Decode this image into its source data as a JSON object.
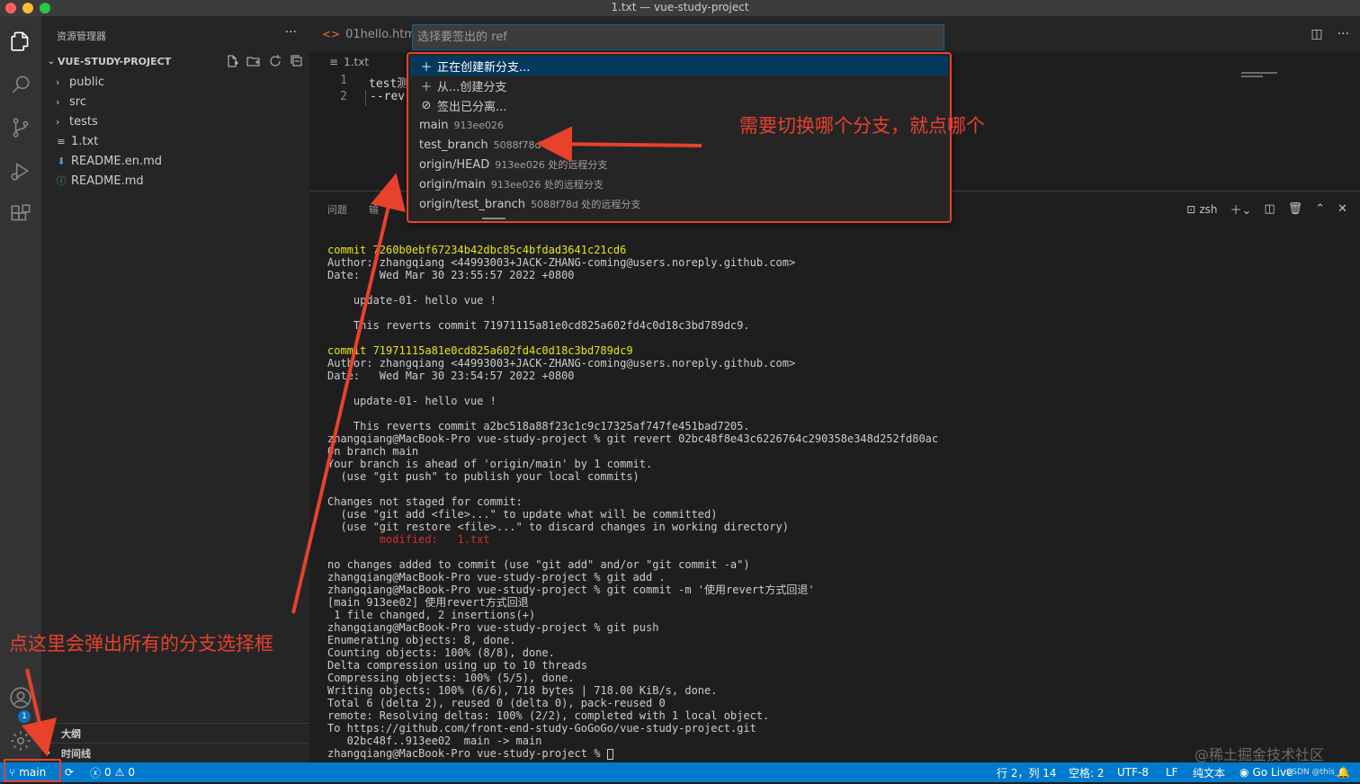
{
  "window": {
    "title": "1.txt — vue-study-project"
  },
  "sidebar": {
    "header": "资源管理器",
    "more": "···",
    "project": "VUE-STUDY-PROJECT",
    "items": [
      {
        "label": "public",
        "kind": "folder"
      },
      {
        "label": "src",
        "kind": "folder"
      },
      {
        "label": "tests",
        "kind": "folder"
      },
      {
        "label": "1.txt",
        "kind": "file-text"
      },
      {
        "label": "README.en.md",
        "kind": "file-md-download"
      },
      {
        "label": "README.md",
        "kind": "file-md-info"
      }
    ],
    "outline": "大纲",
    "timeline": "时间线"
  },
  "tabs": [
    {
      "label": "01hello.html",
      "icon": "code-icon"
    }
  ],
  "breadcrumb": "1.txt",
  "editor": {
    "lines": [
      {
        "num": "1",
        "text": "test测"
      },
      {
        "num": "2",
        "text": "--rev"
      }
    ]
  },
  "quickpick": {
    "placeholder": "选择要签出的 ref",
    "items": [
      {
        "icon": "plus-icon",
        "label": "正在创建新分支...",
        "desc": "",
        "selected": true
      },
      {
        "icon": "plus-icon",
        "label": "从...创建分支",
        "desc": "",
        "selected": false
      },
      {
        "icon": "detach-icon",
        "label": "签出已分离...",
        "desc": "",
        "selected": false
      },
      {
        "icon": "",
        "label": "main",
        "desc": "913ee026",
        "selected": false
      },
      {
        "icon": "",
        "label": "test_branch",
        "desc": "5088f78d",
        "selected": false
      },
      {
        "icon": "",
        "label": "origin/HEAD",
        "desc": "913ee026 处的远程分支",
        "selected": false
      },
      {
        "icon": "",
        "label": "origin/main",
        "desc": "913ee026 处的远程分支",
        "selected": false
      },
      {
        "icon": "",
        "label": "origin/test_branch",
        "desc": "5088f78d 处的远程分支",
        "selected": false
      }
    ]
  },
  "panel": {
    "tabs": [
      "问题",
      "输"
    ],
    "shell": "zsh"
  },
  "terminal": {
    "lines": [
      {
        "text": "commit 7260b0ebf67234b42dbc85c4bfdad3641c21cd6",
        "color": "yellow"
      },
      {
        "text": "Author: zhangqiang <44993003+JACK-ZHANG-coming@users.noreply.github.com>",
        "color": ""
      },
      {
        "text": "Date:   Wed Mar 30 23:55:57 2022 +0800",
        "color": ""
      },
      {
        "text": "",
        "color": ""
      },
      {
        "text": "    update-01- hello vue !",
        "color": ""
      },
      {
        "text": "",
        "color": ""
      },
      {
        "text": "    This reverts commit 71971115a81e0cd825a602fd4c0d18c3bd789dc9.",
        "color": ""
      },
      {
        "text": "",
        "color": ""
      },
      {
        "text": "commit 71971115a81e0cd825a602fd4c0d18c3bd789dc9",
        "color": "yellow"
      },
      {
        "text": "Author: zhangqiang <44993003+JACK-ZHANG-coming@users.noreply.github.com>",
        "color": ""
      },
      {
        "text": "Date:   Wed Mar 30 23:54:57 2022 +0800",
        "color": ""
      },
      {
        "text": "",
        "color": ""
      },
      {
        "text": "    update-01- hello vue !",
        "color": ""
      },
      {
        "text": "",
        "color": ""
      },
      {
        "text": "    This reverts commit a2bc518a88f23c1c9c17325af747fe451bad7205.",
        "color": ""
      },
      {
        "text": "zhangqiang@MacBook-Pro vue-study-project % git revert 02bc48f8e43c6226764c290358e348d252fd80ac",
        "color": ""
      },
      {
        "text": "On branch main",
        "color": ""
      },
      {
        "text": "Your branch is ahead of 'origin/main' by 1 commit.",
        "color": ""
      },
      {
        "text": "  (use \"git push\" to publish your local commits)",
        "color": ""
      },
      {
        "text": "",
        "color": ""
      },
      {
        "text": "Changes not staged for commit:",
        "color": ""
      },
      {
        "text": "  (use \"git add <file>...\" to update what will be committed)",
        "color": ""
      },
      {
        "text": "  (use \"git restore <file>...\" to discard changes in working directory)",
        "color": ""
      },
      {
        "text": "        modified:   1.txt",
        "color": "red"
      },
      {
        "text": "",
        "color": ""
      },
      {
        "text": "no changes added to commit (use \"git add\" and/or \"git commit -a\")",
        "color": ""
      },
      {
        "text": "zhangqiang@MacBook-Pro vue-study-project % git add .",
        "color": ""
      },
      {
        "text": "zhangqiang@MacBook-Pro vue-study-project % git commit -m '使用revert方式回退'",
        "color": ""
      },
      {
        "text": "[main 913ee02] 使用revert方式回退",
        "color": ""
      },
      {
        "text": " 1 file changed, 2 insertions(+)",
        "color": ""
      },
      {
        "text": "zhangqiang@MacBook-Pro vue-study-project % git push",
        "color": ""
      },
      {
        "text": "Enumerating objects: 8, done.",
        "color": ""
      },
      {
        "text": "Counting objects: 100% (8/8), done.",
        "color": ""
      },
      {
        "text": "Delta compression using up to 10 threads",
        "color": ""
      },
      {
        "text": "Compressing objects: 100% (5/5), done.",
        "color": ""
      },
      {
        "text": "Writing objects: 100% (6/6), 718 bytes | 718.00 KiB/s, done.",
        "color": ""
      },
      {
        "text": "Total 6 (delta 2), reused 0 (delta 0), pack-reused 0",
        "color": ""
      },
      {
        "text": "remote: Resolving deltas: 100% (2/2), completed with 1 local object.",
        "color": ""
      },
      {
        "text": "To https://github.com/front-end-study-GoGoGo/vue-study-project.git",
        "color": ""
      },
      {
        "text": "   02bc48f..913ee02  main -> main",
        "color": ""
      },
      {
        "text": "zhangqiang@MacBook-Pro vue-study-project % ",
        "color": "",
        "cursor": true
      }
    ]
  },
  "annotations": {
    "top": "需要切换哪个分支，就点哪个",
    "left": "点这里会弹出所有的分支选择框"
  },
  "statusbar": {
    "branch": "main",
    "errors": "0",
    "warnings": "0",
    "position": "行 2，列 14",
    "spaces": "空格: 2",
    "encoding": "UTF-8",
    "eol": "LF",
    "language": "纯文本",
    "golive": "Go Live",
    "csdn": "CSDN @this_a"
  },
  "watermark": "@稀土掘金技术社区",
  "colors": {
    "accent": "#007acc",
    "annotation": "#e8412c",
    "selection": "#04395e"
  }
}
